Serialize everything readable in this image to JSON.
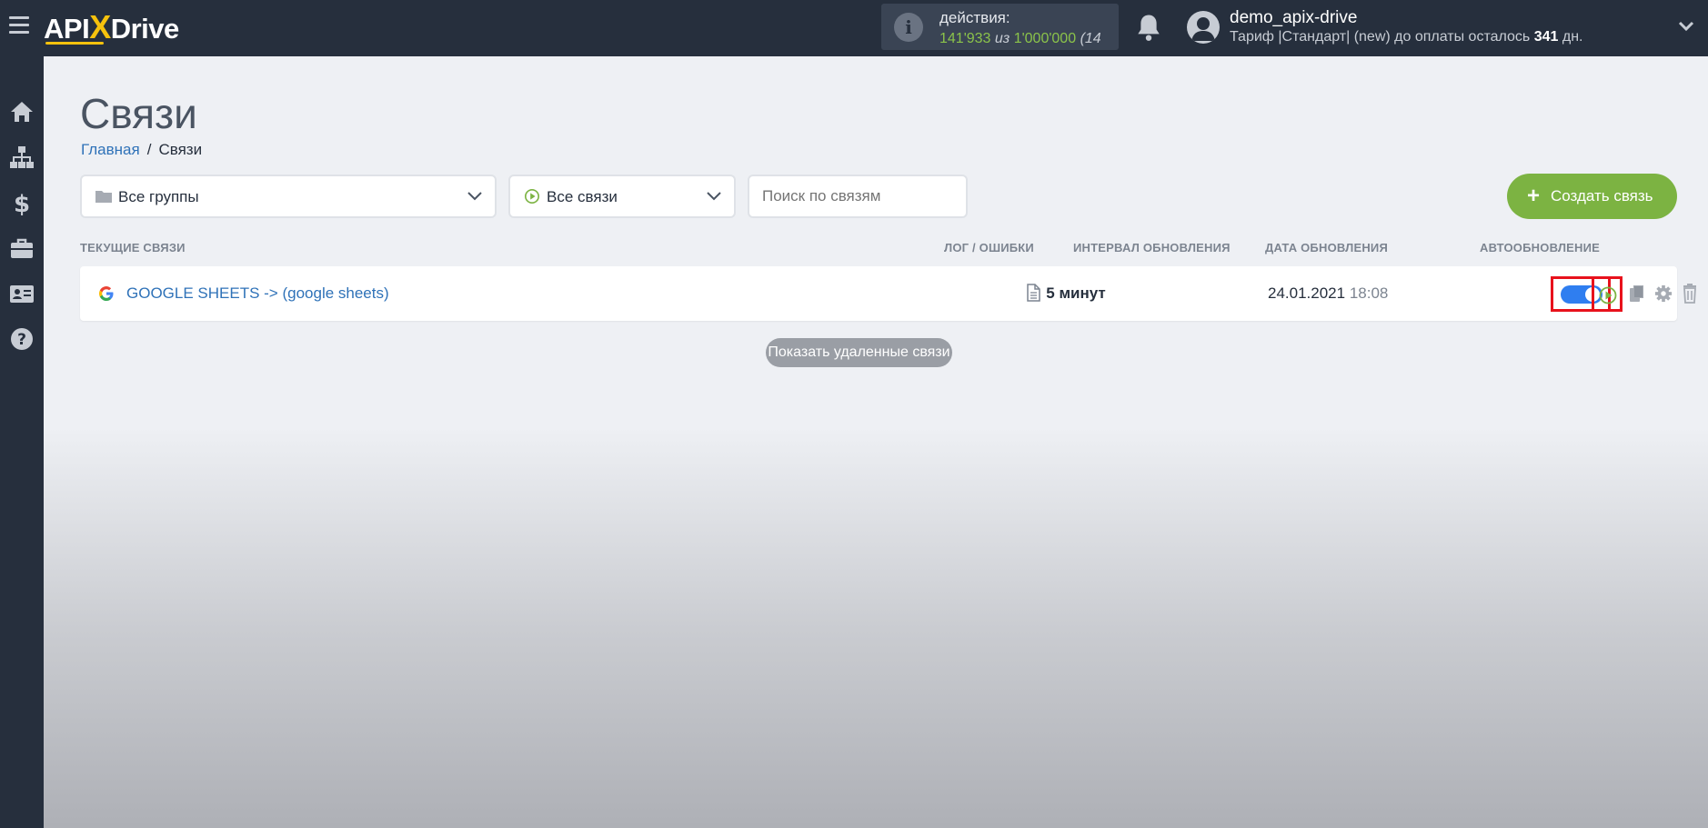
{
  "header": {
    "logo": {
      "part1": "API",
      "x": "X",
      "part2": "Drive"
    },
    "actions": {
      "label": "действия:",
      "used": "141'933",
      "of_word": "из",
      "total": "1'000'000",
      "extra": "(14"
    },
    "user": {
      "name": "demo_apix-drive",
      "plan_prefix": "Тариф |Стандарт| (new) до оплаты осталось",
      "days": "341",
      "days_unit": "дн."
    }
  },
  "sidebar": {
    "items": [
      {
        "icon": "home-icon"
      },
      {
        "icon": "sitemap-icon"
      },
      {
        "icon": "dollar-icon"
      },
      {
        "icon": "briefcase-icon"
      },
      {
        "icon": "id-card-icon"
      },
      {
        "icon": "help-icon"
      }
    ]
  },
  "page": {
    "title": "Связи",
    "breadcrumb": {
      "home": "Главная",
      "separator": "/",
      "current": "Связи"
    }
  },
  "filters": {
    "groups": "Все группы",
    "connections": "Все связи",
    "search_placeholder": "Поиск по связям"
  },
  "create_button": {
    "plus": "+",
    "label": "Создать связь"
  },
  "table": {
    "headers": {
      "current": "ТЕКУЩИЕ СВЯЗИ",
      "log": "ЛОГ / ОШИБКИ",
      "interval": "ИНТЕРВАЛ ОБНОВЛЕНИЯ",
      "date": "ДАТА ОБНОВЛЕНИЯ",
      "auto": "АВТООБНОВЛЕНИЕ"
    },
    "rows": [
      {
        "name": "GOOGLE SHEETS -> (google sheets)",
        "interval": "5 минут",
        "date": "24.01.2021",
        "time": "18:08",
        "auto_update": true
      }
    ]
  },
  "show_deleted": "Показать удаленные связи",
  "colors": {
    "accent_green": "#7cb342",
    "link_blue": "#2f72b8",
    "toggle_blue": "#2f7ef0",
    "highlight_red": "#e8121c",
    "topbar": "#262f3d"
  }
}
